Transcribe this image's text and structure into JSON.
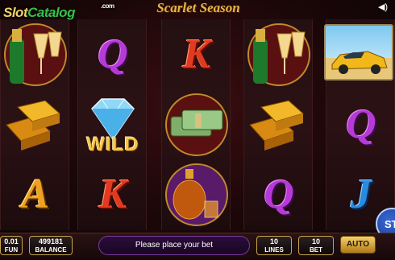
{
  "brand": {
    "part1": "Slot",
    "part2": "Catalog",
    "suffix": ".com"
  },
  "game": {
    "title": "Scarlet Season"
  },
  "reels": [
    [
      "champagne",
      "gold",
      "A"
    ],
    [
      "Q",
      "diamond",
      "K"
    ],
    [
      "K",
      "money",
      "cognac"
    ],
    [
      "champagne",
      "gold",
      "Q"
    ],
    [
      "Q",
      "gold",
      "J"
    ]
  ],
  "wild_label": "WILD",
  "bottom_bar": {
    "fun_value": "0.01",
    "fun_label": "FUN",
    "balance_value": "499181",
    "balance_label": "BALANCE",
    "message": "Please place your bet",
    "lines_value": "10",
    "lines_label": "LINES",
    "bet_value": "10",
    "bet_label": "BET",
    "auto_label": "AUTO",
    "spin_label": "ST"
  },
  "colors": {
    "accent": "#e7b44a",
    "background": "#1a0708",
    "message_bg": "#2a0d3a"
  },
  "icons": [
    "speaker-icon",
    "spin-icon"
  ]
}
